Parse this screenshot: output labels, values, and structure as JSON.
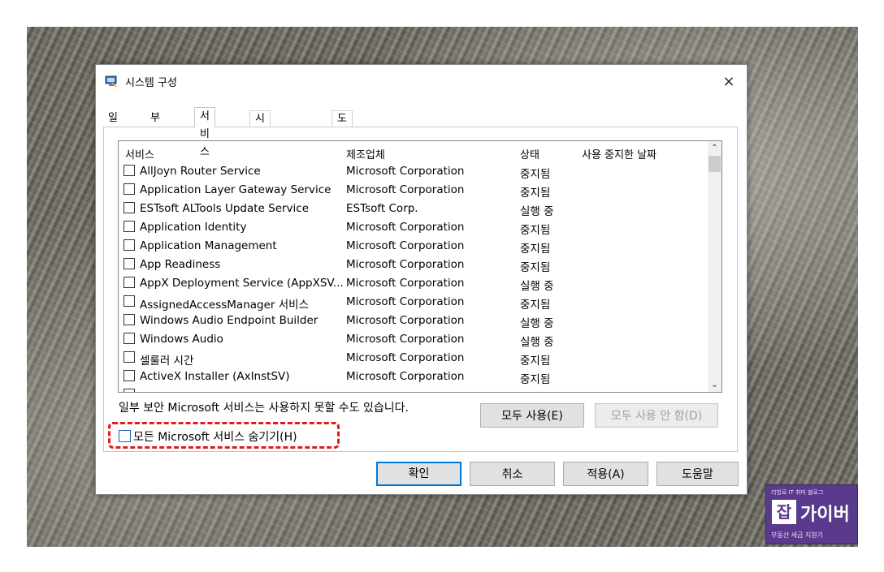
{
  "window": {
    "title": "시스템 구성",
    "close_icon": "×",
    "icon_name": "system-configuration-icon"
  },
  "tabs": [
    {
      "label": "일반"
    },
    {
      "label": "부팅"
    },
    {
      "label": "서비스",
      "active": true
    },
    {
      "label": "시작프로그램"
    },
    {
      "label": "도구"
    }
  ],
  "services": {
    "columns": [
      "서비스",
      "제조업체",
      "상태",
      "사용 중지한 날짜"
    ],
    "rows": [
      {
        "name": "AllJoyn Router Service",
        "manufacturer": "Microsoft Corporation",
        "status": "중지됨"
      },
      {
        "name": "Application Layer Gateway Service",
        "manufacturer": "Microsoft Corporation",
        "status": "중지됨"
      },
      {
        "name": "ESTsoft ALTools Update Service",
        "manufacturer": "ESTsoft Corp.",
        "status": "실행 중"
      },
      {
        "name": "Application Identity",
        "manufacturer": "Microsoft Corporation",
        "status": "중지됨"
      },
      {
        "name": "Application Management",
        "manufacturer": "Microsoft Corporation",
        "status": "중지됨"
      },
      {
        "name": "App Readiness",
        "manufacturer": "Microsoft Corporation",
        "status": "중지됨"
      },
      {
        "name": "AppX Deployment Service (AppXSV...",
        "manufacturer": "Microsoft Corporation",
        "status": "실행 중"
      },
      {
        "name": "AssignedAccessManager 서비스",
        "manufacturer": "Microsoft Corporation",
        "status": "중지됨"
      },
      {
        "name": "Windows Audio Endpoint Builder",
        "manufacturer": "Microsoft Corporation",
        "status": "실행 중"
      },
      {
        "name": "Windows Audio",
        "manufacturer": "Microsoft Corporation",
        "status": "실행 중"
      },
      {
        "name": "셀룰러 시간",
        "manufacturer": "Microsoft Corporation",
        "status": "중지됨"
      },
      {
        "name": "ActiveX Installer (AxInstSV)",
        "manufacturer": "Microsoft Corporation",
        "status": "중지됨"
      }
    ],
    "scroll_up_icon": "⌃",
    "scroll_down_icon": "⌄"
  },
  "note": "일부 보안 Microsoft 서비스는 사용하지 못할 수도 있습니다.",
  "buttons": {
    "enable_all": "모두 사용(E)",
    "disable_all": "모두 사용 안 함(D)",
    "ok": "확인",
    "cancel": "취소",
    "apply": "적용(A)",
    "help": "도움말"
  },
  "hide_ms_services": {
    "label": "모든 Microsoft 서비스 숨기기(H)",
    "checked": false,
    "highlight_color": "#e21b1b"
  },
  "watermark": {
    "top": "리빙로 IT 취미 블로그",
    "box": "잡",
    "name": "가이버",
    "sub": "부동산 세금 지원기"
  }
}
